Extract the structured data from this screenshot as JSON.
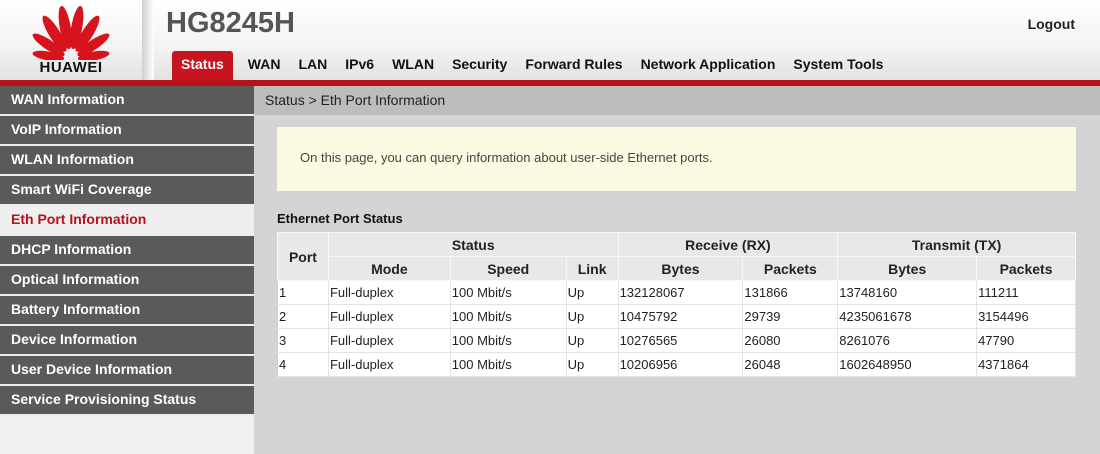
{
  "brand": {
    "logo_text": "HUAWEI",
    "model": "HG8245H",
    "color": "#c8141e"
  },
  "header": {
    "logout_label": "Logout"
  },
  "nav": {
    "items": [
      "Status",
      "WAN",
      "LAN",
      "IPv6",
      "WLAN",
      "Security",
      "Forward Rules",
      "Network Application",
      "System Tools"
    ],
    "active": "Status"
  },
  "sidebar": {
    "items": [
      "WAN Information",
      "VoIP Information",
      "WLAN Information",
      "Smart WiFi Coverage",
      "Eth Port Information",
      "DHCP Information",
      "Optical Information",
      "Battery Information",
      "Device Information",
      "User Device Information",
      "Service Provisioning Status"
    ],
    "active": "Eth Port Information"
  },
  "breadcrumb": "Status > Eth Port Information",
  "info_text": "On this page, you can query information about user-side Ethernet ports.",
  "section_title": "Ethernet Port Status",
  "table": {
    "group_headers": {
      "port": "Port",
      "status": "Status",
      "receive": "Receive (RX)",
      "transmit": "Transmit (TX)"
    },
    "sub_headers": {
      "mode": "Mode",
      "speed": "Speed",
      "link": "Link",
      "rx_bytes": "Bytes",
      "rx_packets": "Packets",
      "tx_bytes": "Bytes",
      "tx_packets": "Packets"
    },
    "rows": [
      {
        "port": "1",
        "mode": "Full-duplex",
        "speed": "100 Mbit/s",
        "link": "Up",
        "rx_bytes": "132128067",
        "rx_packets": "131866",
        "tx_bytes": "13748160",
        "tx_packets": "111211"
      },
      {
        "port": "2",
        "mode": "Full-duplex",
        "speed": "100 Mbit/s",
        "link": "Up",
        "rx_bytes": "10475792",
        "rx_packets": "29739",
        "tx_bytes": "4235061678",
        "tx_packets": "3154496"
      },
      {
        "port": "3",
        "mode": "Full-duplex",
        "speed": "100 Mbit/s",
        "link": "Up",
        "rx_bytes": "10276565",
        "rx_packets": "26080",
        "tx_bytes": "8261076",
        "tx_packets": "47790"
      },
      {
        "port": "4",
        "mode": "Full-duplex",
        "speed": "100 Mbit/s",
        "link": "Up",
        "rx_bytes": "10206956",
        "rx_packets": "26048",
        "tx_bytes": "1602648950",
        "tx_packets": "4371864"
      }
    ]
  }
}
